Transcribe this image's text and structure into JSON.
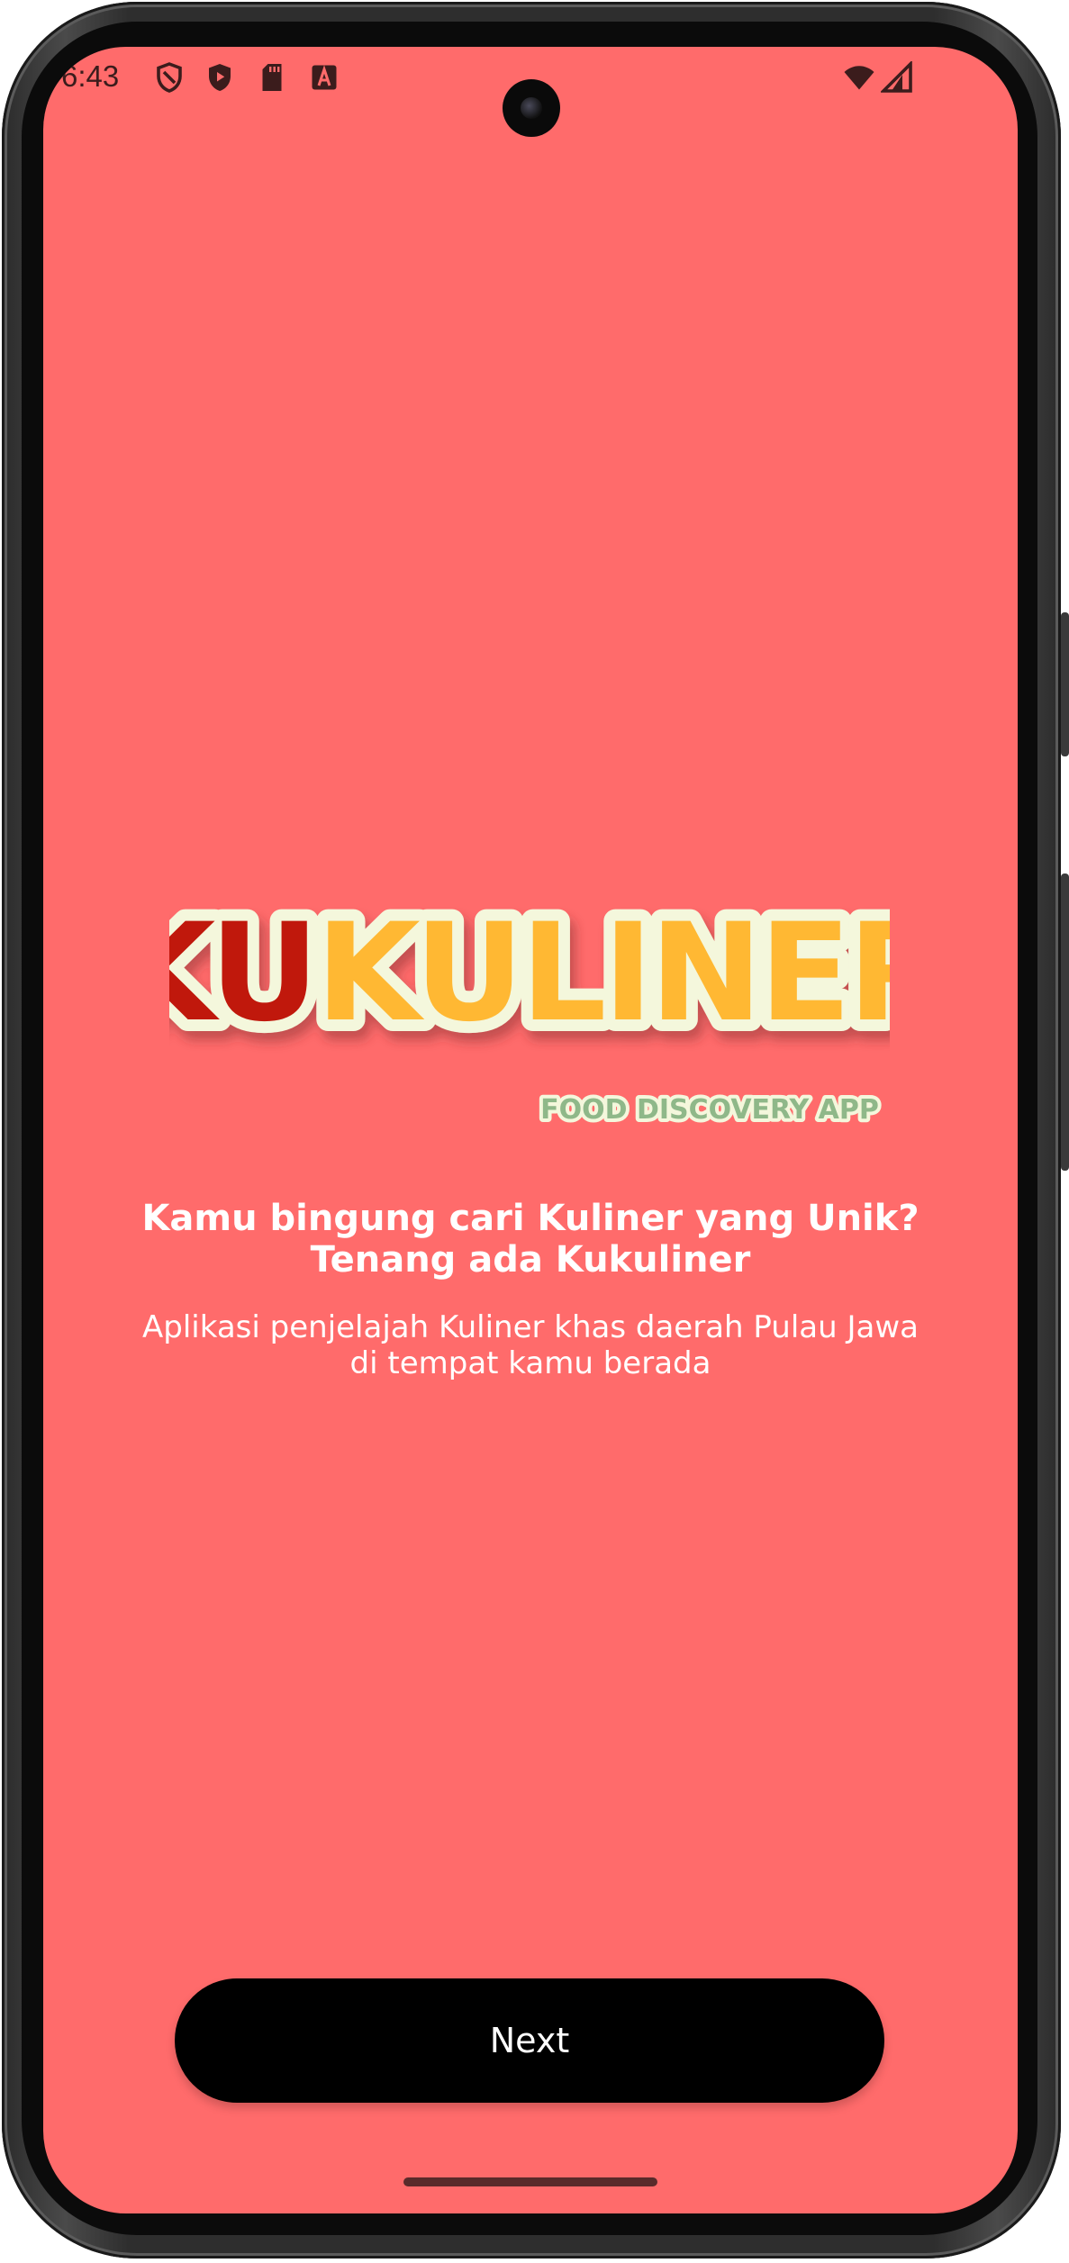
{
  "status_bar": {
    "time": "6:43",
    "icons": [
      "shield-icon",
      "play-protect-icon",
      "sd-card-icon",
      "font-icon",
      "wifi-icon",
      "signal-icon"
    ]
  },
  "logo": {
    "text_part1": "KU",
    "text_part2": "KULINER",
    "tagline": "FOOD DISCOVERY APP"
  },
  "headline": {
    "line1": "Kamu bingung cari Kuliner yang Unik?",
    "line2": "Tenang ada Kukuliner"
  },
  "subtitle": {
    "line1": "Aplikasi penjelajah Kuliner khas daerah Pulau Jawa",
    "line2": "di tempat kamu berada"
  },
  "next_button": {
    "label": "Next"
  },
  "colors": {
    "background": "#ff6b6b",
    "button": "#000000",
    "logo_red": "#c0180c",
    "logo_yellow": "#ffb833",
    "logo_outline": "#f4f7dc",
    "tagline_green": "#8fb889"
  }
}
